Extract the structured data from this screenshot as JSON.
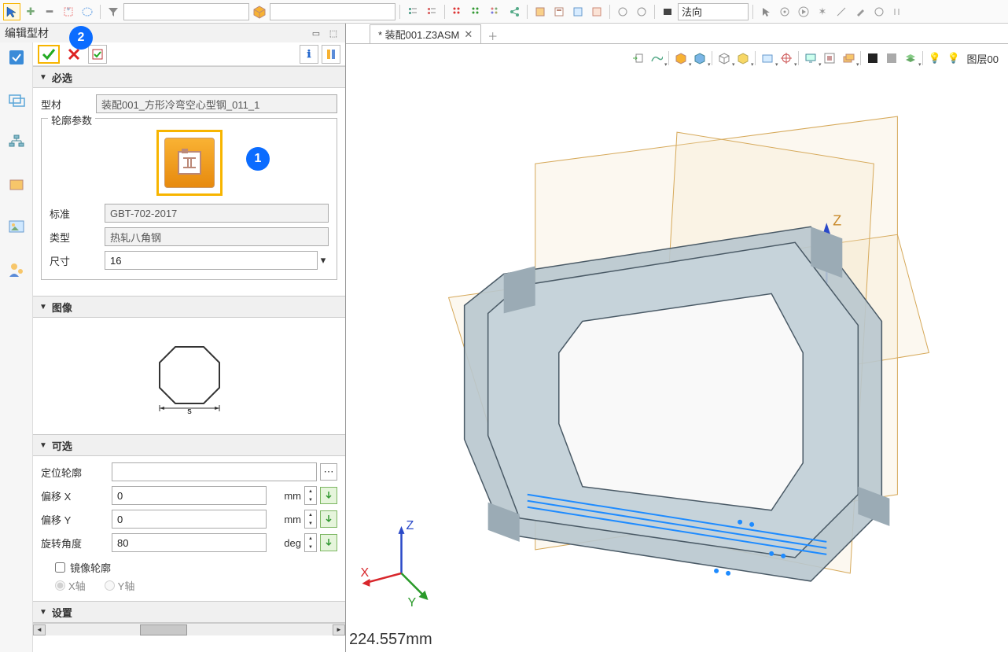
{
  "top": {
    "normal_label": "法向",
    "combo1": "",
    "combo2": ""
  },
  "panel": {
    "title": "编辑型材",
    "required_header": "必选",
    "profile_label": "型材",
    "profile_value": "装配001_方形冷弯空心型钢_011_1",
    "contour_params": "轮廓参数",
    "standard_label": "标准",
    "standard_value": "GBT-702-2017",
    "type_label": "类型",
    "type_value": "热轧八角钢",
    "size_label": "尺寸",
    "size_value": "16",
    "image_header": "图像",
    "image_dim_label": "s",
    "optional_header": "可选",
    "locate_contour_label": "定位轮廓",
    "locate_contour_value": "",
    "offset_x_label": "偏移 X",
    "offset_x_value": "0",
    "offset_y_label": "偏移 Y",
    "offset_y_value": "0",
    "rotate_label": "旋转角度",
    "rotate_value": "80",
    "unit_mm": "mm",
    "unit_deg": "deg",
    "mirror_label": "镜像轮廓",
    "axis_x": "X轴",
    "axis_y": "Y轴",
    "settings_header": "设置"
  },
  "callouts": {
    "one": "1",
    "two": "2"
  },
  "tab": {
    "name": "* 装配001.Z3ASM"
  },
  "viewport": {
    "axis_x": "X",
    "axis_y": "Y",
    "axis_z": "Z",
    "z_top": "Z"
  },
  "status": {
    "text": "224.557mm"
  },
  "view_toolbar": {
    "layer_label": "图层00"
  }
}
